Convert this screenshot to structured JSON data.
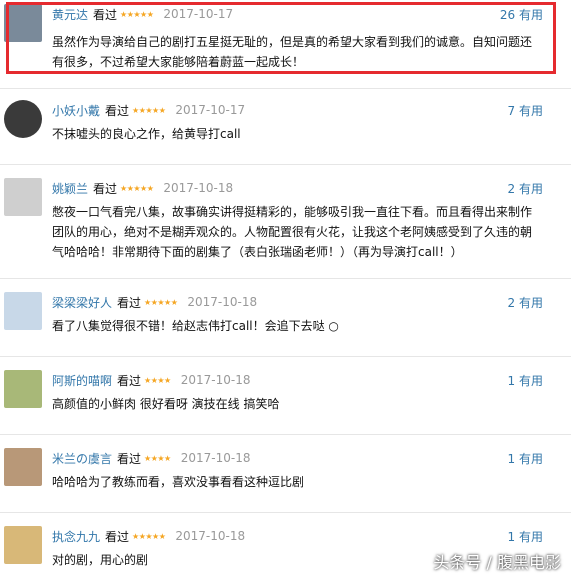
{
  "comments": [
    {
      "user": "黄元达",
      "seen": "看过",
      "stars": "★★★★★",
      "date": "2017-10-17",
      "helpful": "26 有用",
      "text": "虽然作为导演给自己的剧打五星挺无耻的，但是真的希望大家看到我们的诚意。自知问题还有很多，不过希望大家能够陪着蔚蓝一起成长！",
      "avatar_color": "#7a8a9a"
    },
    {
      "user": "小妖小戴",
      "seen": "看过",
      "stars": "★★★★★",
      "date": "2017-10-17",
      "helpful": "7 有用",
      "text": "不抹嘘头的良心之作，给黄导打call",
      "avatar_color": "#3a3a3a"
    },
    {
      "user": "姚颖兰",
      "seen": "看过",
      "stars": "★★★★★",
      "date": "2017-10-18",
      "helpful": "2 有用",
      "text": "憋夜一口气看完八集，故事确实讲得挺精彩的，能够吸引我一直往下看。而且看得出来制作团队的用心，绝对不是糊弄观众的。人物配置很有火花，让我这个老阿姨感受到了久违的朝气哈哈哈！非常期待下面的剧集了（表白张瑞函老师！）（再为导演打call！）",
      "avatar_color": "#cfcfcf"
    },
    {
      "user": "梁梁梁好人",
      "seen": "看过",
      "stars": "★★★★★",
      "date": "2017-10-18",
      "helpful": "2 有用",
      "text": "看了八集觉得很不错！给赵志伟打call！会追下去哒 ○",
      "avatar_color": "#c8d8e8"
    },
    {
      "user": "阿斯的喵啊",
      "seen": "看过",
      "stars": "★★★★",
      "date": "2017-10-18",
      "helpful": "1 有用",
      "text": "高颜值的小鲜肉 很好看呀 演技在线 搞笑哈",
      "avatar_color": "#a8b878"
    },
    {
      "user": "米兰の虞言",
      "seen": "看过",
      "stars": "★★★★",
      "date": "2017-10-18",
      "helpful": "1 有用",
      "text": "哈哈哈为了教练而看，喜欢没事看看这种逗比剧",
      "avatar_color": "#b89878"
    },
    {
      "user": "执念九九",
      "seen": "看过",
      "stars": "★★★★★",
      "date": "2017-10-18",
      "helpful": "1 有用",
      "text": "对的剧，用心的剧",
      "avatar_color": "#d8b878"
    }
  ],
  "watermark": "头条号 / 腹黑电影"
}
